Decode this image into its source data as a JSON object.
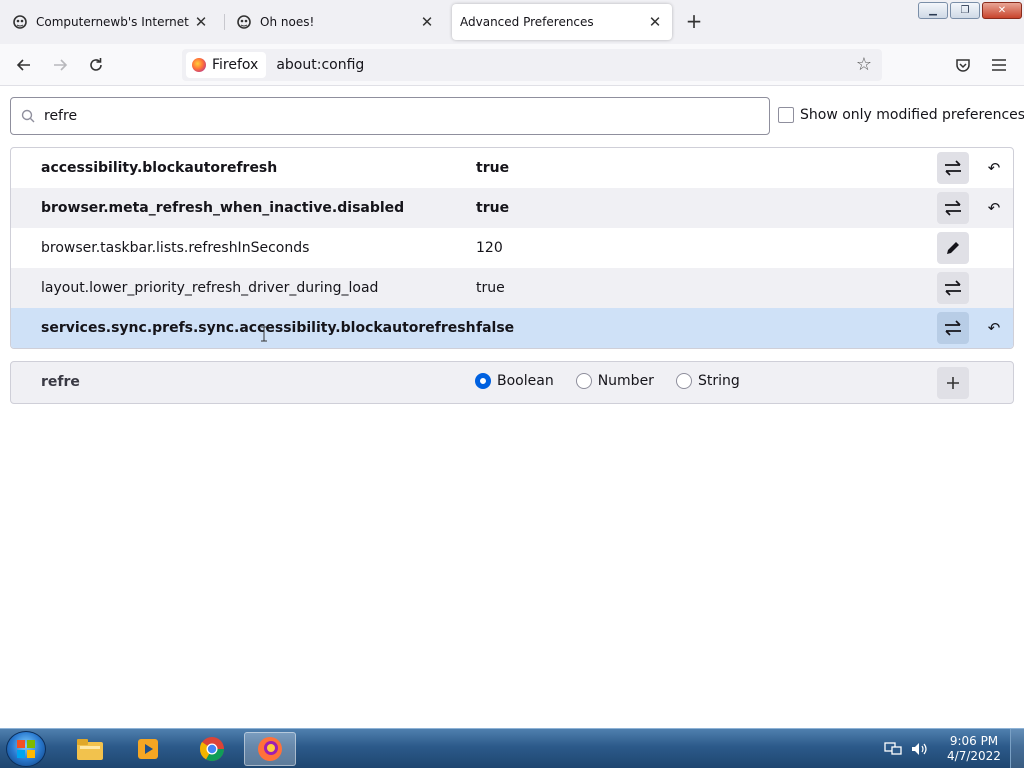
{
  "tabs": [
    {
      "title": "Computernewb's Internet Pub Hu",
      "active": false
    },
    {
      "title": "Oh noes!",
      "active": false
    },
    {
      "title": "Advanced Preferences",
      "active": true
    }
  ],
  "navbar": {
    "identity_label": "Firefox",
    "url": "about:config"
  },
  "search": {
    "value": "refre",
    "show_modified_label": "Show only modified preferences"
  },
  "preferences": [
    {
      "name": "accessibility.blockautorefresh",
      "value": "true",
      "modified": true,
      "action": "toggle"
    },
    {
      "name": "browser.meta_refresh_when_inactive.disabled",
      "value": "true",
      "modified": true,
      "action": "toggle"
    },
    {
      "name": "browser.taskbar.lists.refreshInSeconds",
      "value": "120",
      "modified": false,
      "action": "edit"
    },
    {
      "name": "layout.lower_priority_refresh_driver_during_load",
      "value": "true",
      "modified": false,
      "action": "toggle"
    },
    {
      "name": "services.sync.prefs.sync.accessibility.blockautorefresh",
      "value": "false",
      "modified": true,
      "action": "toggle"
    }
  ],
  "add_row": {
    "name": "refre",
    "types": [
      "Boolean",
      "Number",
      "String"
    ],
    "selected_type": "Boolean"
  },
  "taskbar": {
    "time": "9:06 PM",
    "date": "4/7/2022"
  },
  "colors": {
    "accent": "#0061e0",
    "selected_row": "#cfe1f7",
    "alt_row": "#f0f0f4"
  }
}
